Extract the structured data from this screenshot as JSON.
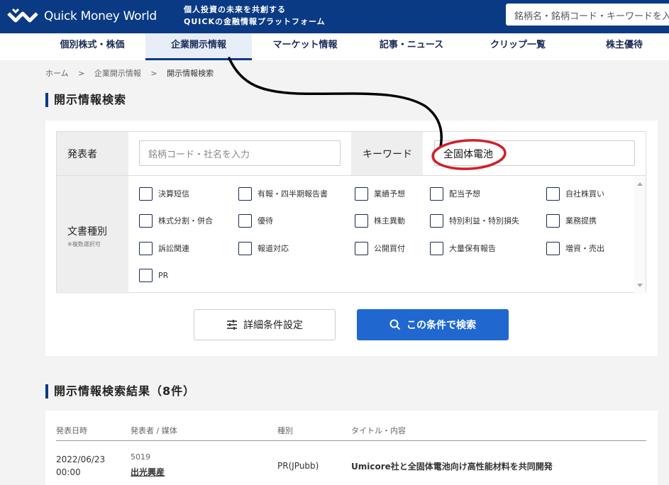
{
  "header": {
    "logo_text": "Quick Money World",
    "tagline_line1": "個人投資の未来を共創する",
    "tagline_line2": "QUICKの金融情報プラットフォーム",
    "search_placeholder": "銘柄名・銘柄コード・キーワードを入"
  },
  "nav": {
    "items": [
      {
        "label": "個別株式・株価"
      },
      {
        "label": "企業開示情報"
      },
      {
        "label": "マーケット情報"
      },
      {
        "label": "記事・ニュース"
      },
      {
        "label": "クリップ一覧"
      },
      {
        "label": "株主優待"
      }
    ],
    "active_index": 1
  },
  "breadcrumb": {
    "items": [
      "ホーム",
      ">",
      "企業開示情報",
      ">",
      "開示情報検索"
    ]
  },
  "search_section": {
    "title": "開示情報検索",
    "publisher_label": "発表者",
    "publisher_placeholder": "銘柄コード・社名を入力",
    "keyword_label": "キーワード",
    "keyword_value": "全固体電池",
    "doc_type_label": "文書種別",
    "doc_type_note": "※複数選択可",
    "doc_types": [
      "決算短信",
      "有報・四半期報告書",
      "業績予想",
      "配当予想",
      "自社株買い",
      "株式分割・併合",
      "優待",
      "株主異動",
      "特別利益・特別損失",
      "業務提携",
      "訴訟関連",
      "報道対応",
      "公開買付",
      "大量保有報告",
      "増資・売出",
      "PR"
    ],
    "detail_button": "詳細条件設定",
    "search_button": "この条件で検索"
  },
  "results": {
    "title": "開示情報検索結果（8件）",
    "columns": [
      "発表日時",
      "発表者 / 媒体",
      "種別",
      "タイトル・内容"
    ],
    "rows": [
      {
        "date": "2022/06/23",
        "time": "00:00",
        "code": "5019",
        "company": "出光興産",
        "type": "PR(JPubb)",
        "title": "Umicore社と全固体電池向け高性能材料を共同開発"
      }
    ]
  },
  "colors": {
    "header_bg": "#0a3a84",
    "search_button": "#2068d0",
    "annotation_circle": "#d0202a"
  }
}
